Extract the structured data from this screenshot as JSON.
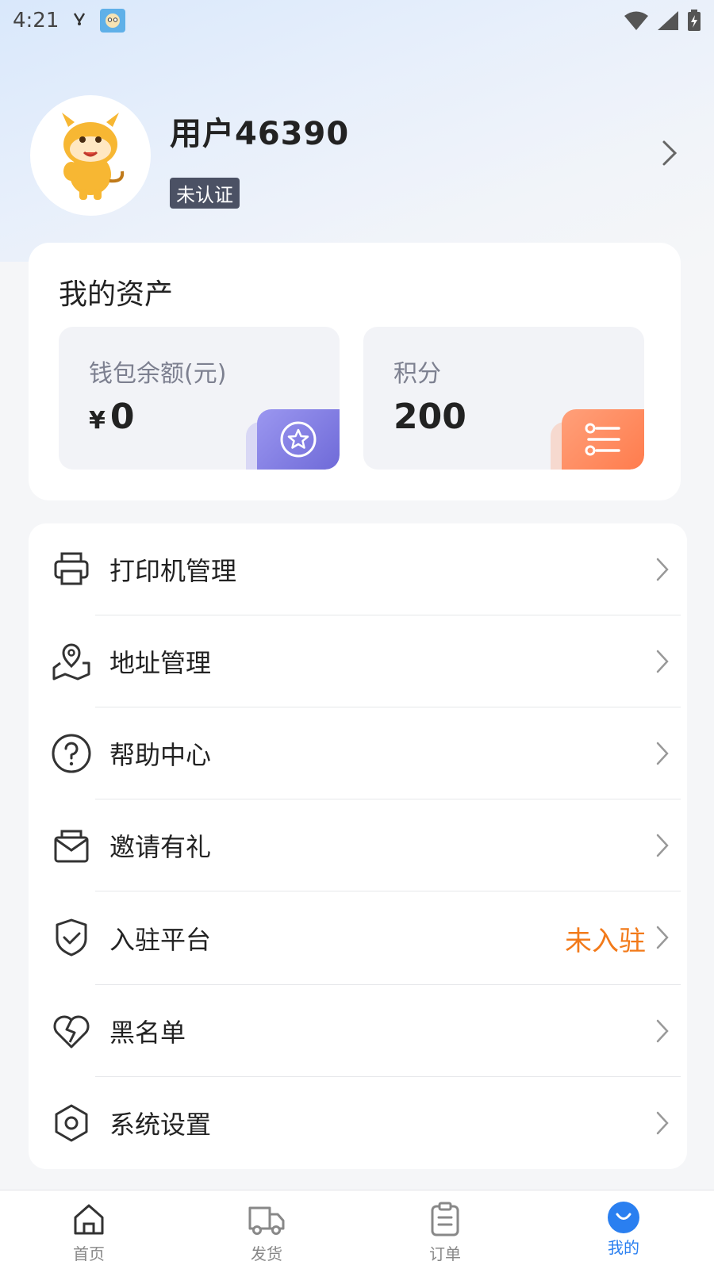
{
  "status_bar": {
    "time": "4:21",
    "notification_icon": "v-icon"
  },
  "profile": {
    "username": "用户46390",
    "verification_badge": "未认证",
    "avatar_icon": "cow-mascot-icon"
  },
  "assets": {
    "title": "我的资产",
    "wallet": {
      "label": "钱包余额(元)",
      "currency": "¥",
      "value": "0",
      "accent": "#7c78e0"
    },
    "points": {
      "label": "积分",
      "value": "200",
      "accent": "#ff8a5c"
    }
  },
  "menu": {
    "items": [
      {
        "label": "打印机管理",
        "icon": "printer-icon"
      },
      {
        "label": "地址管理",
        "icon": "map-pin-icon"
      },
      {
        "label": "帮助中心",
        "icon": "question-icon"
      },
      {
        "label": "邀请有礼",
        "icon": "envelope-icon"
      },
      {
        "label": "入驻平台",
        "icon": "shield-check-icon",
        "extra": "未入驻"
      },
      {
        "label": "黑名单",
        "icon": "broken-heart-icon"
      },
      {
        "label": "系统设置",
        "icon": "settings-hexagon-icon"
      }
    ]
  },
  "bottom_nav": {
    "items": [
      {
        "label": "首页",
        "icon": "home-icon"
      },
      {
        "label": "发货",
        "icon": "truck-icon"
      },
      {
        "label": "订单",
        "icon": "clipboard-icon"
      },
      {
        "label": "我的",
        "icon": "profile-icon",
        "active": true
      }
    ]
  },
  "colors": {
    "accent_blue": "#2a7ff0",
    "status_orange": "#f27a1a",
    "badge_dark": "#4b5164"
  }
}
